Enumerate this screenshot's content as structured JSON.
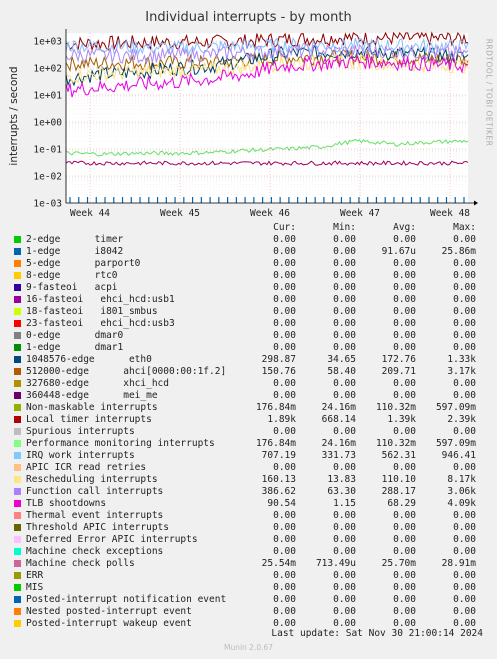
{
  "chart_data": {
    "type": "line",
    "title": "Individual interrupts - by month",
    "ylabel": "interrupts / second",
    "side_label": "RRDTOOL / TOBI OETIKER",
    "yscale": "log",
    "ylim": [
      0.001,
      2000
    ],
    "y_ticks": [
      "1e-03",
      "1e-02",
      "1e-01",
      "1e+00",
      "1e+01",
      "1e+02",
      "1e+03"
    ],
    "x_ticks": [
      "Week 44",
      "Week 45",
      "Week 46",
      "Week 47",
      "Week 48"
    ],
    "series": [
      {
        "name": "Local timer interrupts",
        "color": "#8c0000",
        "values": [
          800,
          830,
          880,
          900,
          920,
          1000,
          1150,
          1300,
          1350,
          1300,
          1250,
          1300
        ]
      },
      {
        "name": "512000-edge ahci[0000:00:1f.2]",
        "color": "#a06000",
        "values": [
          150,
          150,
          160,
          160,
          165,
          200,
          240,
          250,
          260,
          240,
          220,
          200
        ]
      },
      {
        "name": "1048576-edge eth0",
        "color": "#004060",
        "values": [
          40,
          60,
          70,
          100,
          120,
          200,
          350,
          380,
          400,
          350,
          300,
          250
        ]
      },
      {
        "name": "IRQ work interrupts",
        "color": "#88bbff",
        "values": [
          700,
          650,
          600,
          550,
          600,
          650,
          700,
          720,
          700,
          680,
          650,
          600
        ]
      },
      {
        "name": "Function call interrupts",
        "color": "#aa88ee",
        "values": [
          300,
          300,
          280,
          300,
          320,
          380,
          420,
          430,
          420,
          400,
          380,
          350
        ]
      },
      {
        "name": "Rescheduling interrupts",
        "color": "#ffe080",
        "values": [
          50,
          60,
          70,
          80,
          90,
          110,
          150,
          160,
          170,
          150,
          130,
          120
        ]
      },
      {
        "name": "Non-maskable interrupts",
        "color": "#e600e6",
        "values": [
          15,
          20,
          25,
          30,
          40,
          60,
          120,
          150,
          180,
          160,
          140,
          120
        ]
      },
      {
        "name": "Machine check polls",
        "color": "#66e066",
        "values": [
          0.07,
          0.065,
          0.07,
          0.07,
          0.075,
          0.09,
          0.1,
          0.12,
          0.2,
          0.15,
          0.18,
          0.2
        ]
      },
      {
        "name": "Spurious interrupts",
        "color": "#a00060",
        "values": [
          0.03,
          0.03,
          0.03,
          0.03,
          0.03,
          0.03,
          0.03,
          0.03,
          0.03,
          0.03,
          0.03,
          0.03
        ]
      }
    ]
  },
  "legend": {
    "headers": [
      "Cur:",
      "Min:",
      "Avg:",
      "Max:"
    ],
    "rows": [
      {
        "label": "2-edge      timer",
        "color": "#00cc00",
        "cur": "0.00",
        "min": "0.00",
        "avg": "0.00",
        "max": "0.00"
      },
      {
        "label": "1-edge      i8042",
        "color": "#0066b3",
        "cur": "0.00",
        "min": "0.00",
        "avg": "91.67u",
        "max": "25.86m"
      },
      {
        "label": "5-edge      parport0",
        "color": "#ff8000",
        "cur": "0.00",
        "min": "0.00",
        "avg": "0.00",
        "max": "0.00"
      },
      {
        "label": "8-edge      rtc0",
        "color": "#ffcc00",
        "cur": "0.00",
        "min": "0.00",
        "avg": "0.00",
        "max": "0.00"
      },
      {
        "label": "9-fasteoi   acpi",
        "color": "#330099",
        "cur": "0.00",
        "min": "0.00",
        "avg": "0.00",
        "max": "0.00"
      },
      {
        "label": "16-fasteoi   ehci_hcd:usb1",
        "color": "#990099",
        "cur": "0.00",
        "min": "0.00",
        "avg": "0.00",
        "max": "0.00"
      },
      {
        "label": "18-fasteoi   i801_smbus",
        "color": "#ccff00",
        "cur": "0.00",
        "min": "0.00",
        "avg": "0.00",
        "max": "0.00"
      },
      {
        "label": "23-fasteoi   ehci_hcd:usb3",
        "color": "#ff0000",
        "cur": "0.00",
        "min": "0.00",
        "avg": "0.00",
        "max": "0.00"
      },
      {
        "label": "0-edge      dmar0",
        "color": "#808080",
        "cur": "0.00",
        "min": "0.00",
        "avg": "0.00",
        "max": "0.00"
      },
      {
        "label": "1-edge      dmar1",
        "color": "#008f00",
        "cur": "0.00",
        "min": "0.00",
        "avg": "0.00",
        "max": "0.00"
      },
      {
        "label": "1048576-edge      eth0",
        "color": "#00487d",
        "cur": "298.87",
        "min": "34.65",
        "avg": "172.76",
        "max": "1.33k"
      },
      {
        "label": "512000-edge      ahci[0000:00:1f.2]",
        "color": "#b35a00",
        "cur": "150.76",
        "min": "58.40",
        "avg": "209.71",
        "max": "3.17k"
      },
      {
        "label": "327680-edge      xhci_hcd",
        "color": "#b38f00",
        "cur": "0.00",
        "min": "0.00",
        "avg": "0.00",
        "max": "0.00"
      },
      {
        "label": "360448-edge      mei_me",
        "color": "#6b006b",
        "cur": "0.00",
        "min": "0.00",
        "avg": "0.00",
        "max": "0.00"
      },
      {
        "label": "Non-maskable interrupts",
        "color": "#8fb300",
        "cur": "176.84m",
        "min": "24.16m",
        "avg": "110.32m",
        "max": "597.09m"
      },
      {
        "label": "Local timer interrupts",
        "color": "#b30000",
        "cur": "1.89k",
        "min": "668.14",
        "avg": "1.39k",
        "max": "2.39k"
      },
      {
        "label": "Spurious interrupts",
        "color": "#bebebe",
        "cur": "0.00",
        "min": "0.00",
        "avg": "0.00",
        "max": "0.00"
      },
      {
        "label": "Performance monitoring interrupts",
        "color": "#80ff80",
        "cur": "176.84m",
        "min": "24.16m",
        "avg": "110.32m",
        "max": "597.09m"
      },
      {
        "label": "IRQ work interrupts",
        "color": "#80c9ff",
        "cur": "707.19",
        "min": "331.73",
        "avg": "562.31",
        "max": "946.41"
      },
      {
        "label": "APIC ICR read retries",
        "color": "#ffc080",
        "cur": "0.00",
        "min": "0.00",
        "avg": "0.00",
        "max": "0.00"
      },
      {
        "label": "Rescheduling interrupts",
        "color": "#ffe680",
        "cur": "160.13",
        "min": "13.83",
        "avg": "110.10",
        "max": "8.17k"
      },
      {
        "label": "Function call interrupts",
        "color": "#aa80ff",
        "cur": "386.62",
        "min": "63.30",
        "avg": "288.17",
        "max": "3.06k"
      },
      {
        "label": "TLB shootdowns",
        "color": "#ee00cc",
        "cur": "90.54",
        "min": "1.15",
        "avg": "68.29",
        "max": "4.09k"
      },
      {
        "label": "Thermal event interrupts",
        "color": "#ff8080",
        "cur": "0.00",
        "min": "0.00",
        "avg": "0.00",
        "max": "0.00"
      },
      {
        "label": "Threshold APIC interrupts",
        "color": "#666600",
        "cur": "0.00",
        "min": "0.00",
        "avg": "0.00",
        "max": "0.00"
      },
      {
        "label": "Deferred Error APIC interrupts",
        "color": "#ffbfff",
        "cur": "0.00",
        "min": "0.00",
        "avg": "0.00",
        "max": "0.00"
      },
      {
        "label": "Machine check exceptions",
        "color": "#00ffcc",
        "cur": "0.00",
        "min": "0.00",
        "avg": "0.00",
        "max": "0.00"
      },
      {
        "label": "Machine check polls",
        "color": "#cc6699",
        "cur": "25.54m",
        "min": "713.49u",
        "avg": "25.70m",
        "max": "28.91m"
      },
      {
        "label": "ERR",
        "color": "#999900",
        "cur": "0.00",
        "min": "0.00",
        "avg": "0.00",
        "max": "0.00"
      },
      {
        "label": "MIS",
        "color": "#00cc00",
        "cur": "0.00",
        "min": "0.00",
        "avg": "0.00",
        "max": "0.00"
      },
      {
        "label": "Posted-interrupt notification event",
        "color": "#0066b3",
        "cur": "0.00",
        "min": "0.00",
        "avg": "0.00",
        "max": "0.00"
      },
      {
        "label": "Nested posted-interrupt event",
        "color": "#ff8000",
        "cur": "0.00",
        "min": "0.00",
        "avg": "0.00",
        "max": "0.00"
      },
      {
        "label": "Posted-interrupt wakeup event",
        "color": "#ffcc00",
        "cur": "0.00",
        "min": "0.00",
        "avg": "0.00",
        "max": "0.00"
      }
    ]
  },
  "footer": {
    "last_update": "Last update: Sat Nov 30 21:00:14 2024",
    "version": "Munin 2.0.67"
  }
}
